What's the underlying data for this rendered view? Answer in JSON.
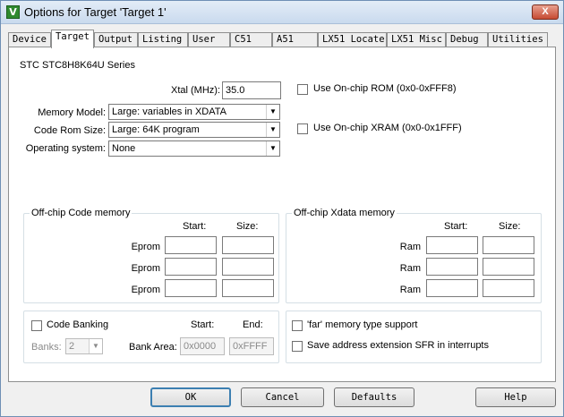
{
  "window": {
    "title": "Options for Target 'Target 1'",
    "icon_label": "V",
    "close_label": "X"
  },
  "tabs": [
    "Device",
    "Target",
    "Output",
    "Listing",
    "User",
    "C51",
    "A51",
    "LX51 Locate",
    "LX51 Misc",
    "Debug",
    "Utilities"
  ],
  "active_tab": "Target",
  "target": {
    "device_name": "STC STC8H8K64U Series",
    "xtal_label": "Xtal (MHz):",
    "xtal_value": "35.0",
    "onchip_rom_label": "Use On-chip ROM (0x0-0xFFF8)",
    "onchip_xram_label": "Use On-chip XRAM (0x0-0x1FFF)",
    "memory_model_label": "Memory Model:",
    "memory_model_value": "Large: variables in XDATA",
    "code_rom_size_label": "Code Rom Size:",
    "code_rom_size_value": "Large: 64K program",
    "operating_system_label": "Operating system:",
    "operating_system_value": "None"
  },
  "offchip_code": {
    "title": "Off-chip Code memory",
    "start_header": "Start:",
    "size_header": "Size:",
    "rows": [
      "Eprom",
      "Eprom",
      "Eprom"
    ]
  },
  "offchip_xdata": {
    "title": "Off-chip Xdata memory",
    "start_header": "Start:",
    "size_header": "Size:",
    "rows": [
      "Ram",
      "Ram",
      "Ram"
    ]
  },
  "banking": {
    "code_banking_label": "Code Banking",
    "start_header": "Start:",
    "end_header": "End:",
    "banks_label": "Banks:",
    "banks_value": "2",
    "bank_area_label": "Bank Area:",
    "bank_area_start": "0x0000",
    "bank_area_end": "0xFFFF"
  },
  "options": {
    "far_memory_label": "'far' memory type support",
    "save_sfr_label": "Save address extension SFR in interrupts"
  },
  "buttons": {
    "ok": "OK",
    "cancel": "Cancel",
    "defaults": "Defaults",
    "help": "Help"
  }
}
